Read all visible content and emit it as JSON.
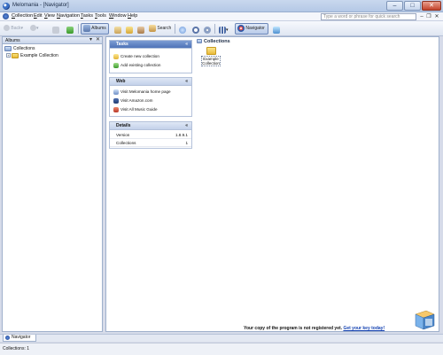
{
  "window": {
    "title": "Melomania - [Navigator]",
    "controls": {
      "minimize": "–",
      "maximize": "□",
      "close": "✕"
    }
  },
  "menu": {
    "items": [
      {
        "label": "Collection",
        "underline": "C",
        "rest": "ollection"
      },
      {
        "label": "Edit",
        "underline": "E",
        "rest": "dit"
      },
      {
        "label": "View",
        "underline": "V",
        "rest": "iew"
      },
      {
        "label": "Navigation",
        "underline": "N",
        "rest": "avigation"
      },
      {
        "label": "Tasks",
        "underline": "T",
        "rest": "asks"
      },
      {
        "label": "Tools",
        "underline": "T",
        "rest": "ools"
      },
      {
        "label": "Window",
        "underline": "W",
        "rest": "indow"
      },
      {
        "label": "Help",
        "underline": "H",
        "rest": "elp"
      }
    ],
    "search_placeholder": "Type a word or phrase for quick search",
    "mdi": {
      "minimize": "–",
      "restore": "❐",
      "close": "✕"
    }
  },
  "toolbar": {
    "back": "Back",
    "albums": "Albums",
    "search": "Search",
    "navigator": "Navigator"
  },
  "left_panel": {
    "title": "Albums",
    "pin": "▾",
    "close": "✕",
    "tree": [
      {
        "label": "Collections",
        "level": 0
      },
      {
        "label": "Example Collection",
        "level": 1,
        "expander": "+"
      }
    ]
  },
  "tasks": {
    "title": "Tasks",
    "collapse": "«",
    "items": [
      "Create new collection",
      "Add existing collection"
    ]
  },
  "web": {
    "title": "Web",
    "collapse": "«",
    "items": [
      "Visit Melomania home page",
      "Visit Amazon.com",
      "Visit All Music Guide"
    ]
  },
  "details": {
    "title": "Details",
    "collapse": "«",
    "rows": [
      {
        "key": "Version",
        "value": "1.8.9.1"
      },
      {
        "key": "Collections",
        "value": "1"
      }
    ]
  },
  "collections_view": {
    "title": "Collections",
    "items": [
      {
        "label": "Example Collection",
        "line1": "Example",
        "line2": "Collection"
      }
    ]
  },
  "notice": {
    "text": "Your copy of the program is not registered yet.",
    "link": "Get your key today!"
  },
  "bottom_tab": {
    "label": "Navigator"
  },
  "status": {
    "text": "Collections: 1"
  },
  "colors": {
    "accent": "#4e73b8",
    "link": "#1845b3",
    "folder": "#e9ba3a"
  }
}
